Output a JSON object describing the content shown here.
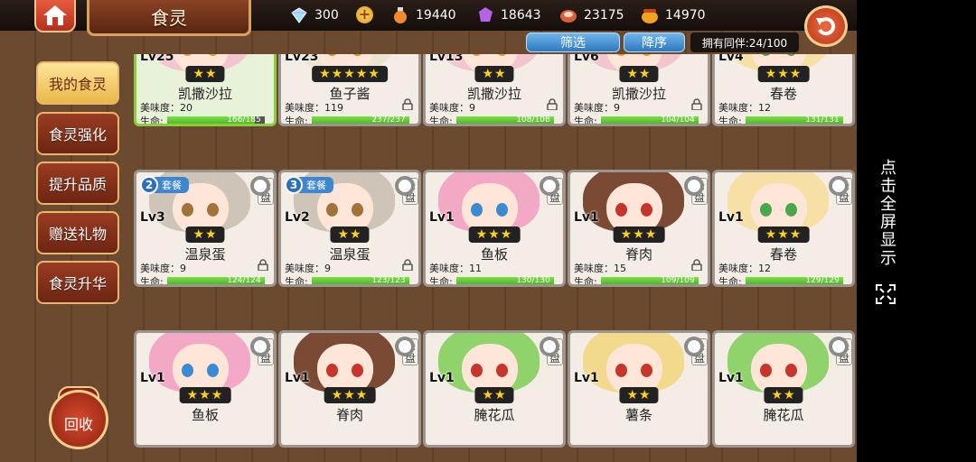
{
  "header": {
    "title": "食灵",
    "resources": {
      "crystal": "300",
      "potion": "19440",
      "gem": "18643",
      "meat": "23175",
      "honey": "14970"
    },
    "filter_label": "筛选",
    "sort_label": "降序",
    "partner_count": "拥有同伴:24/100"
  },
  "sidebar": {
    "items": [
      {
        "label": "我的食灵"
      },
      {
        "label": "食灵强化"
      },
      {
        "label": "提升品质"
      },
      {
        "label": "赠送礼物"
      },
      {
        "label": "食灵升华"
      }
    ],
    "recycle_label": "回收"
  },
  "cards": [
    {
      "level": "Lv25",
      "stars": "★★",
      "name": "凯撒沙拉",
      "taste": "美味度：20",
      "hp": "166/185",
      "hp_pct": 0.9,
      "tag": "头盘"
    },
    {
      "level": "Lv23",
      "stars": "★★★★★",
      "name": "鱼子酱",
      "taste": "美味度：119",
      "hp": "237/237",
      "hp_pct": 1.0,
      "tag": "头盘"
    },
    {
      "level": "Lv13",
      "stars": "★★",
      "name": "凯撒沙拉",
      "taste": "美味度：9",
      "hp": "108/108",
      "hp_pct": 1.0,
      "tag": "头盘"
    },
    {
      "level": "Lv6",
      "stars": "★★",
      "name": "凯撒沙拉",
      "taste": "美味度：9",
      "hp": "104/104",
      "hp_pct": 1.0,
      "tag": "头盘"
    },
    {
      "level": "Lv4",
      "stars": "★★★",
      "name": "春卷",
      "taste": "美味度：12",
      "hp": "131/131",
      "hp_pct": 1.0,
      "tag": "头盘"
    },
    {
      "level": "Lv3",
      "stars": "★★",
      "name": "温泉蛋",
      "taste": "美味度：9",
      "hp": "124/124",
      "hp_pct": 1.0,
      "tag": "头盘",
      "set_num": "2",
      "set_label": "套餐"
    },
    {
      "level": "Lv2",
      "stars": "★★",
      "name": "温泉蛋",
      "taste": "美味度：9",
      "hp": "123/123",
      "hp_pct": 1.0,
      "tag": "头盘",
      "set_num": "3",
      "set_label": "套餐"
    },
    {
      "level": "Lv1",
      "stars": "★★★",
      "name": "鱼板",
      "taste": "美味度：11",
      "hp": "130/130",
      "hp_pct": 1.0,
      "tag": "头盘"
    },
    {
      "level": "Lv1",
      "stars": "★★★",
      "name": "脊肉",
      "taste": "美味度：15",
      "hp": "109/109",
      "hp_pct": 1.0,
      "tag": "头盘"
    },
    {
      "level": "Lv1",
      "stars": "★★★",
      "name": "春卷",
      "taste": "美味度：12",
      "hp": "129/129",
      "hp_pct": 1.0,
      "tag": "头盘"
    },
    {
      "level": "Lv1",
      "stars": "★★★",
      "name": "鱼板",
      "tag": "头盘"
    },
    {
      "level": "Lv1",
      "stars": "★★★",
      "name": "脊肉",
      "tag": "头盘"
    },
    {
      "level": "Lv1",
      "stars": "★★",
      "name": "腌花瓜",
      "tag": "头盘"
    },
    {
      "level": "Lv1",
      "stars": "★★",
      "name": "薯条",
      "tag": "头盘"
    },
    {
      "level": "Lv1",
      "stars": "★★",
      "name": "腌花瓜",
      "tag": "头盘"
    }
  ],
  "fullscreen_hint": "点击全屏显示",
  "colors": {
    "accent": "#e8b949",
    "hp_green": "#4fc21f",
    "select_blue": "#2f78bd"
  }
}
